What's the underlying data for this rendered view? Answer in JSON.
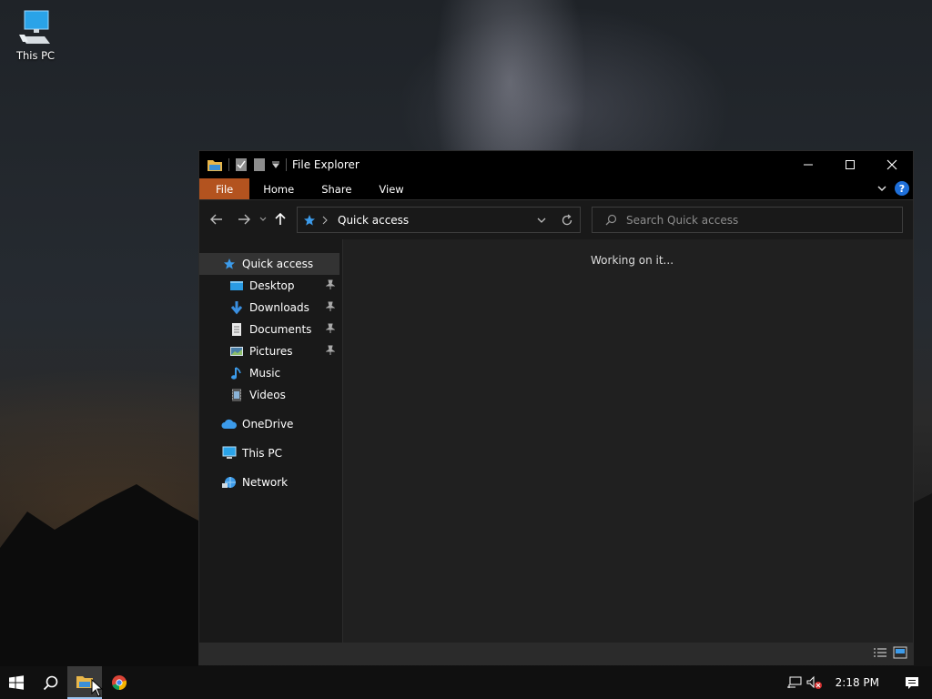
{
  "desktop": {
    "icons": [
      {
        "label": "This PC",
        "icon": "this-pc-icon"
      }
    ]
  },
  "window": {
    "title": "File Explorer",
    "ribbon_tabs": [
      "File",
      "Home",
      "Share",
      "View"
    ],
    "address": "Quick access",
    "search_placeholder": "Search Quick access",
    "status_message": "Working on it...",
    "accent_color": "#b3531f"
  },
  "nav_pane": {
    "quick_access": "Quick access",
    "pinned": [
      {
        "label": "Desktop",
        "icon": "desktop-folder-icon",
        "pinned": true
      },
      {
        "label": "Downloads",
        "icon": "downloads-icon",
        "pinned": true
      },
      {
        "label": "Documents",
        "icon": "documents-icon",
        "pinned": true
      },
      {
        "label": "Pictures",
        "icon": "pictures-icon",
        "pinned": true
      },
      {
        "label": "Music",
        "icon": "music-icon",
        "pinned": false
      },
      {
        "label": "Videos",
        "icon": "videos-icon",
        "pinned": false
      }
    ],
    "onedrive": "OneDrive",
    "this_pc": "This PC",
    "network": "Network"
  },
  "taskbar": {
    "time": "2:18 PM",
    "apps": [
      "start-icon",
      "search-icon",
      "file-explorer-icon",
      "chrome-icon"
    ]
  }
}
